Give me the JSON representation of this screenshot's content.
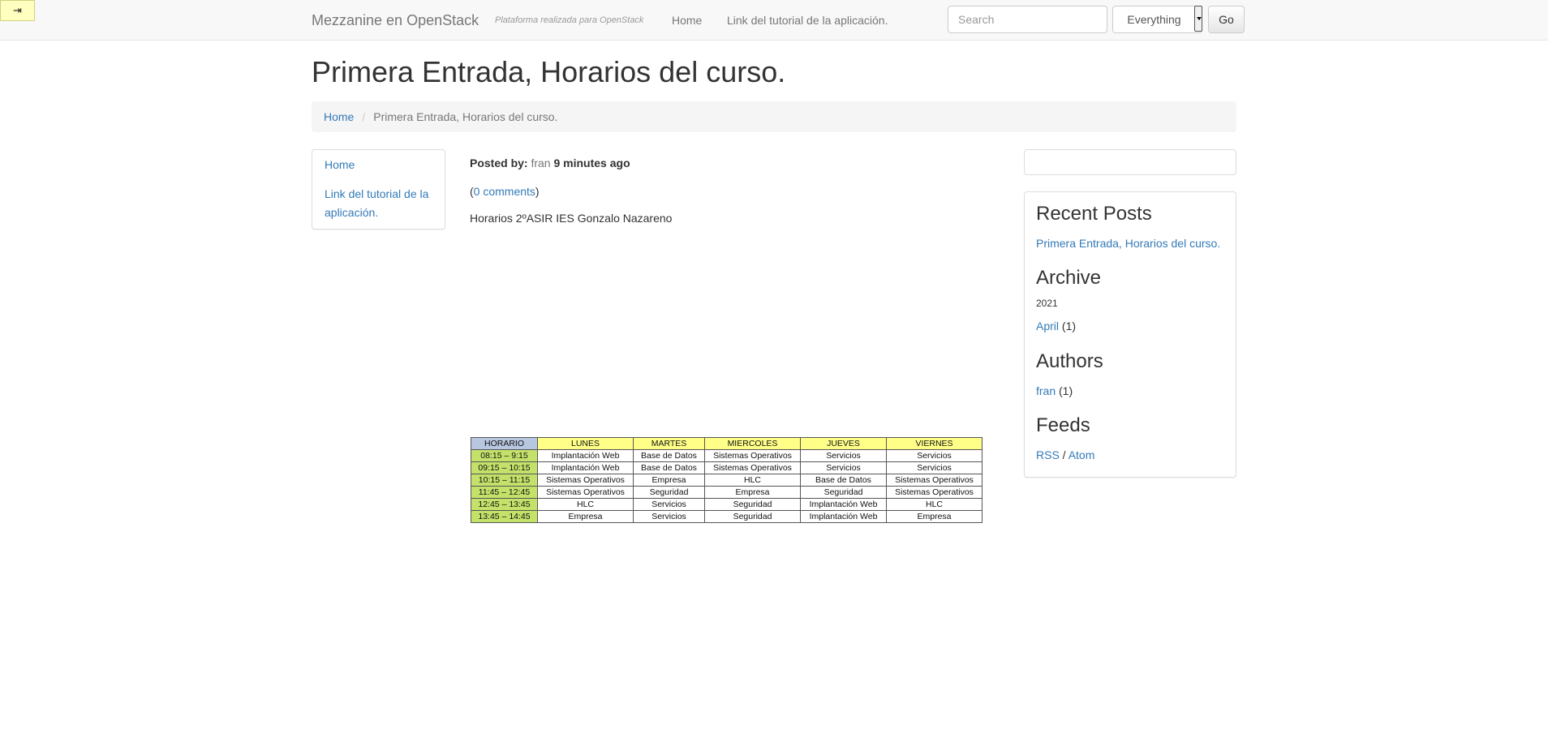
{
  "toggle": {
    "icon": "⇥",
    "icon_name": "sidebar-toggle-icon"
  },
  "navbar": {
    "brand": "Mezzanine en OpenStack",
    "tagline": "Plataforma realizada para OpenStack",
    "links": [
      "Home",
      "Link del tutorial de la aplicación."
    ],
    "search_placeholder": "Search",
    "search_scope": "Everything",
    "go_label": "Go"
  },
  "page": {
    "title": "Primera Entrada, Horarios del curso."
  },
  "breadcrumb": {
    "home": "Home",
    "separator": "/",
    "current": "Primera Entrada, Horarios del curso."
  },
  "left_nav": {
    "items": [
      "Home",
      "Link del tutorial de la aplicación."
    ]
  },
  "post": {
    "posted_by_label": "Posted by:",
    "author": "fran",
    "time": "9 minutes ago",
    "comments_open": "(",
    "comments_link": "0 comments",
    "comments_close": ")",
    "body": "Horarios 2ºASIR IES Gonzalo Nazareno"
  },
  "schedule": {
    "headers": [
      "HORARIO",
      "LUNES",
      "MARTES",
      "MIERCOLES",
      "JUEVES",
      "VIERNES"
    ],
    "rows": [
      [
        "08:15 – 9:15",
        "Implantación Web",
        "Base de Datos",
        "Sistemas Operativos",
        "Servicios",
        "Servicios"
      ],
      [
        "09:15 – 10:15",
        "Implantación Web",
        "Base de Datos",
        "Sistemas Operativos",
        "Servicios",
        "Servicios"
      ],
      [
        "10:15 – 11:15",
        "Sistemas Operativos",
        "Empresa",
        "HLC",
        "Base de Datos",
        "Sistemas Operativos"
      ],
      [
        "11:45 – 12:45",
        "Sistemas Operativos",
        "Seguridad",
        "Empresa",
        "Seguridad",
        "Sistemas Operativos"
      ],
      [
        "12:45 – 13:45",
        "HLC",
        "Servicios",
        "Seguridad",
        "Implantación Web",
        "HLC"
      ],
      [
        "13:45 – 14:45",
        "Empresa",
        "Servicios",
        "Seguridad",
        "Implantación Web",
        "Empresa"
      ]
    ]
  },
  "sidebar": {
    "recent_posts_title": "Recent Posts",
    "recent_posts": [
      "Primera Entrada, Horarios del curso."
    ],
    "archive_title": "Archive",
    "archive_year": "2021",
    "archive_month": "April",
    "archive_month_count": "(1)",
    "authors_title": "Authors",
    "author_name": "fran",
    "author_count": "(1)",
    "feeds_title": "Feeds",
    "feed_rss": "RSS",
    "feed_sep": " / ",
    "feed_atom": "Atom"
  }
}
